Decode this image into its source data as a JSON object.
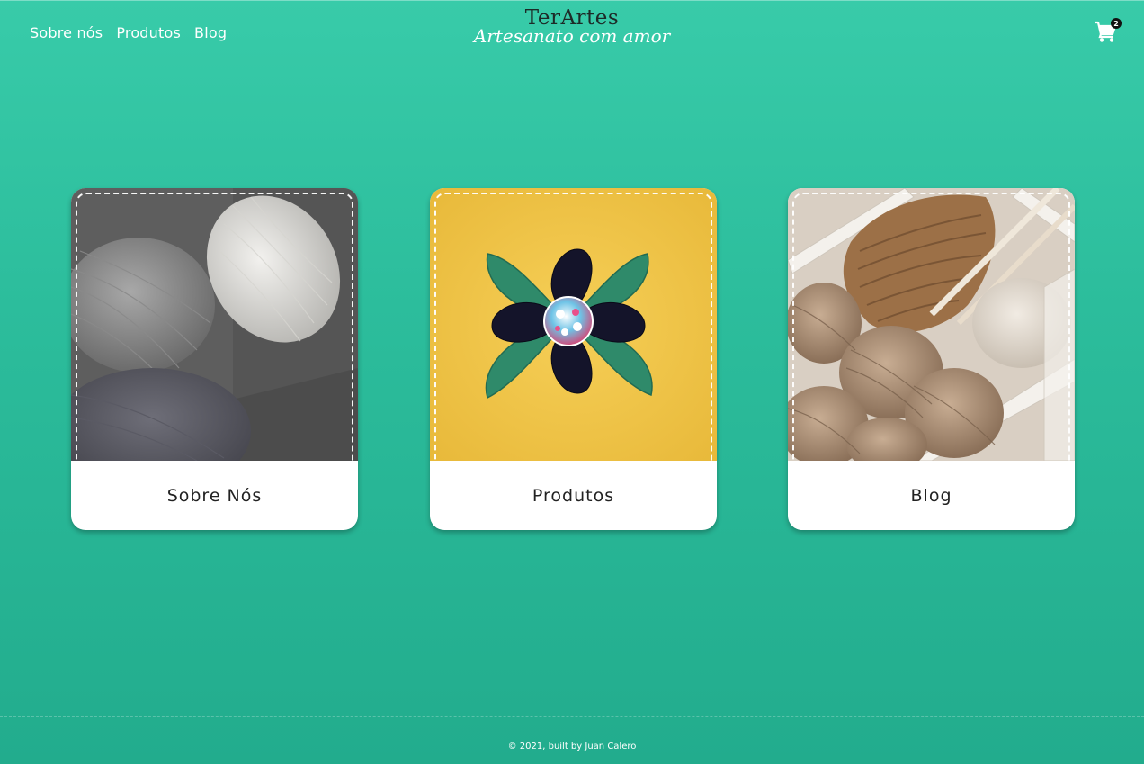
{
  "header": {
    "nav": [
      {
        "label": "Sobre nós"
      },
      {
        "label": "Produtos"
      },
      {
        "label": "Blog"
      }
    ],
    "brand": {
      "name": "TerArtes",
      "tagline": "Artesanato com amor"
    },
    "cart": {
      "icon": "shopping-cart-icon",
      "count": "2"
    }
  },
  "cards": [
    {
      "label": "Sobre Nós",
      "image": "yarn-balls-grayscale-photo"
    },
    {
      "label": "Produtos",
      "image": "fabric-flower-photo"
    },
    {
      "label": "Blog",
      "image": "knitting-basket-photo"
    }
  ],
  "footer": {
    "text": "© 2021, built by Juan Calero"
  },
  "colors": {
    "background": "#2cbd9c",
    "brand_text": "#1d2a27",
    "card_background": "#ffffff"
  }
}
